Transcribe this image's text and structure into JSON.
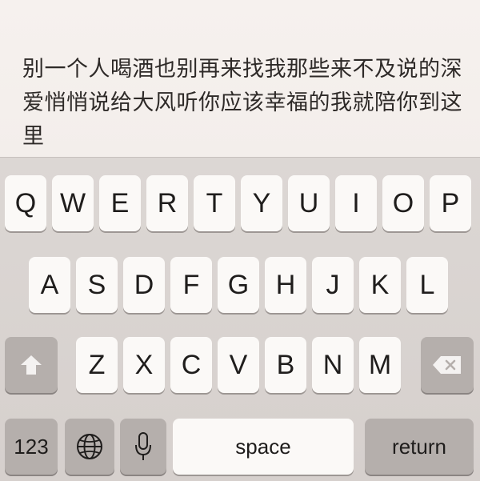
{
  "note": {
    "text": "别一个人喝酒也别再来找我那些来不及说的深爱悄悄说给大风听你应该幸福的我就陪你到这里"
  },
  "keyboard": {
    "row1": [
      "Q",
      "W",
      "E",
      "R",
      "T",
      "Y",
      "U",
      "I",
      "O",
      "P"
    ],
    "row2": [
      "A",
      "S",
      "D",
      "F",
      "G",
      "H",
      "J",
      "K",
      "L"
    ],
    "row3": [
      "Z",
      "X",
      "C",
      "V",
      "B",
      "N",
      "M"
    ],
    "numbers_label": "123",
    "space_label": "space",
    "return_label": "return",
    "icons": {
      "shift": "shift-arrow-icon",
      "delete": "backspace-icon",
      "globe": "globe-icon",
      "mic": "microphone-icon"
    }
  }
}
